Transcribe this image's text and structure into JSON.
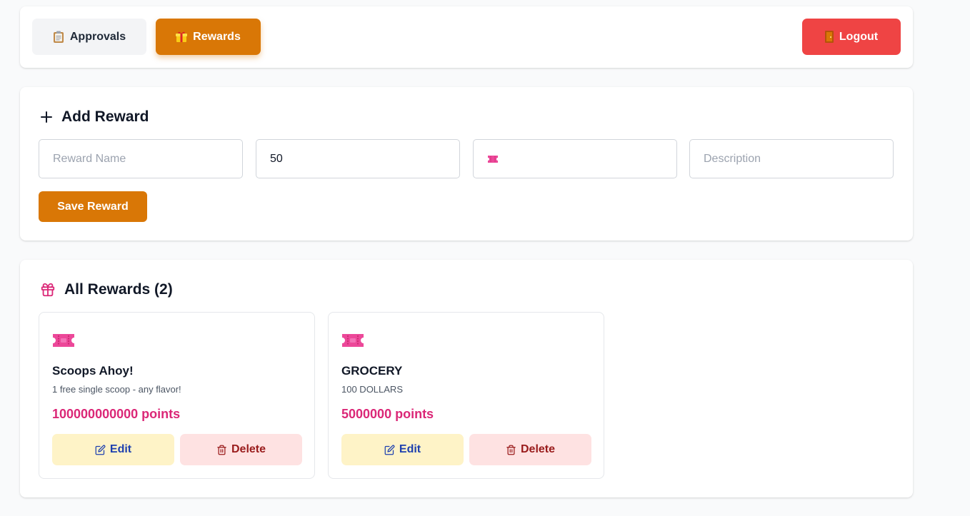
{
  "colors": {
    "accent_orange": "#d97706",
    "logout_red": "#ef4444",
    "pink": "#db2777",
    "edit_bg": "#fef3c7",
    "edit_text": "#1e40af",
    "delete_bg": "#fee2e2",
    "delete_text": "#991b1b"
  },
  "nav": {
    "approvals": {
      "label": "Approvals",
      "icon": "clipboard-icon"
    },
    "rewards": {
      "label": "Rewards",
      "icon": "gift-icon",
      "active": true
    },
    "logout": {
      "label": "Logout",
      "icon": "door-icon"
    }
  },
  "add_reward": {
    "title": "Add Reward",
    "title_icon": "plus-icon",
    "fields": {
      "name": {
        "value": "",
        "placeholder": "Reward Name"
      },
      "points": {
        "value": "50",
        "placeholder": ""
      },
      "emoji": {
        "value": "ticket-icon",
        "placeholder": ""
      },
      "description": {
        "value": "",
        "placeholder": "Description"
      }
    },
    "save_label": "Save Reward"
  },
  "all_rewards": {
    "title": "All Rewards (2)",
    "title_icon": "gift-outline-icon",
    "items": [
      {
        "icon": "ticket-icon",
        "name": "Scoops Ahoy!",
        "description": "1 free single scoop - any flavor!",
        "points": "100000000000 points",
        "edit_label": "Edit",
        "delete_label": "Delete"
      },
      {
        "icon": "ticket-icon",
        "name": "GROCERY",
        "description": "100 DOLLARS",
        "points": "5000000 points",
        "edit_label": "Edit",
        "delete_label": "Delete"
      }
    ]
  }
}
